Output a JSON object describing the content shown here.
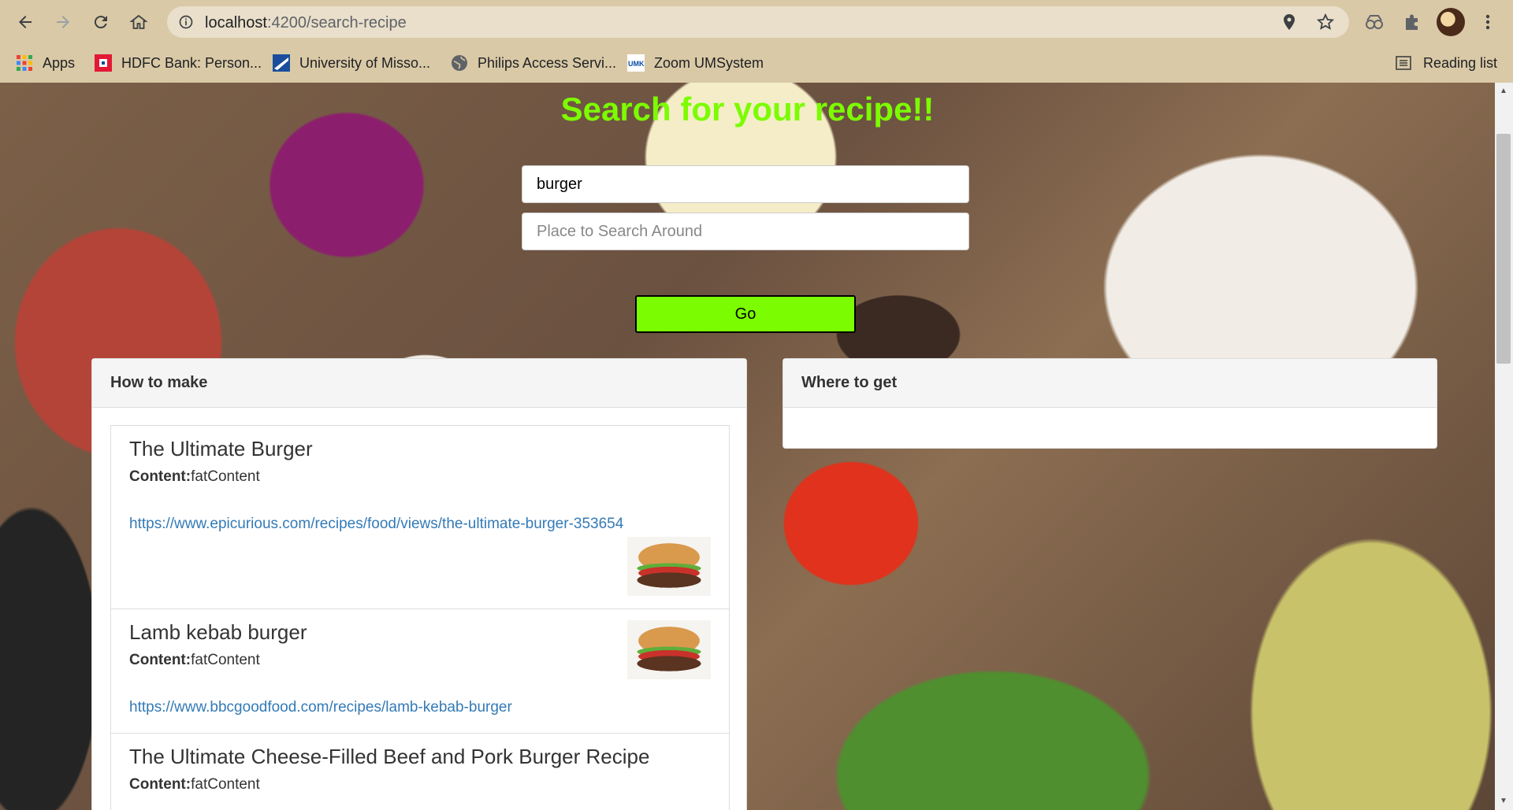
{
  "browser": {
    "url_host": "localhost",
    "url_rest": ":4200/search-recipe",
    "bookmarks": [
      {
        "label": "Apps",
        "icon": "apps-grid-icon"
      },
      {
        "label": "HDFC Bank: Person...",
        "icon": "hdfc-icon"
      },
      {
        "label": "University of Misso...",
        "icon": "university-icon"
      },
      {
        "label": "Philips Access Servi...",
        "icon": "globe-icon"
      },
      {
        "label": "Zoom UMSystem",
        "icon": "umkc-icon"
      }
    ],
    "reading_list": "Reading list"
  },
  "page": {
    "title": "Search for your recipe!!",
    "search_value": "burger",
    "place_placeholder": "Place to Search Around",
    "go_label": "Go"
  },
  "how_to_make": {
    "heading": "How to make",
    "content_label": "Content:",
    "items": [
      {
        "title": "The Ultimate Burger",
        "content": "fatContent",
        "url": "https://www.epicurious.com/recipes/food/views/the-ultimate-burger-353654"
      },
      {
        "title": "Lamb kebab burger",
        "content": "fatContent",
        "url": "https://www.bbcgoodfood.com/recipes/lamb-kebab-burger"
      },
      {
        "title": "The Ultimate Cheese-Filled Beef and Pork Burger Recipe",
        "content": "fatContent",
        "url": ""
      }
    ]
  },
  "where_to_get": {
    "heading": "Where to get"
  }
}
